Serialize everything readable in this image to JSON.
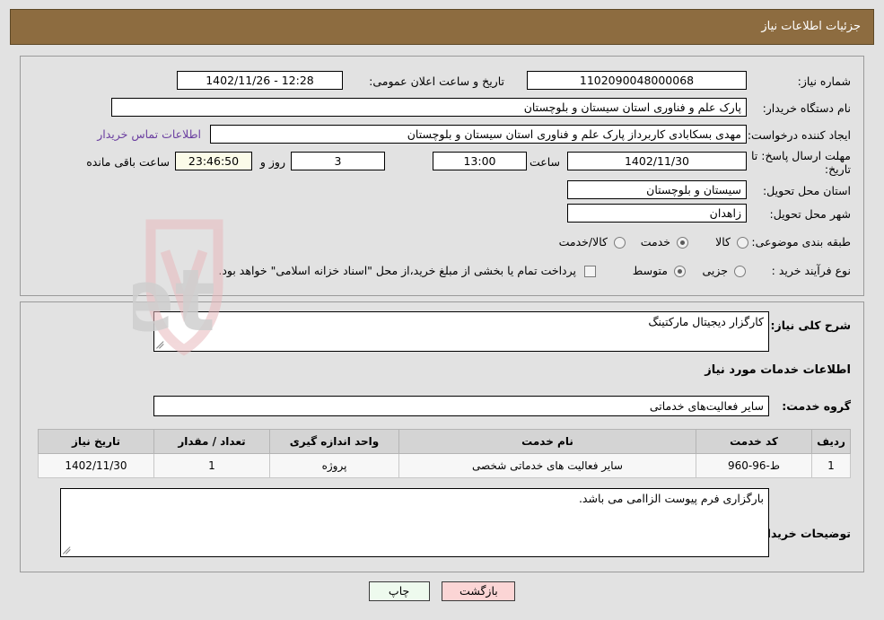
{
  "header": {
    "title": "جزئیات اطلاعات نیاز"
  },
  "colors": {
    "header_bg": "#8d6c40",
    "page_bg": "#e2e2e2",
    "link": "#6b3fa0",
    "timer_field_bg": "#fbfbe8",
    "print_btn_bg": "#eefaee",
    "back_btn_bg": "#fbd5d5",
    "watermark": "#c9c9c9",
    "watermark_logo": "#e8b9bd"
  },
  "top_section": {
    "need_number": {
      "label": "شماره نیاز:",
      "value": "1102090048000068"
    },
    "public_announce": {
      "label": "تاریخ و ساعت اعلان عمومی:",
      "value": "12:28 - 1402/11/26"
    },
    "buyer_org": {
      "label": "نام دستگاه خریدار:",
      "value": "پارک علم و فناوری استان سیستان و بلوچستان"
    },
    "request_creator": {
      "label": "ایجاد کننده درخواست:",
      "value": "مهدی بسکابادی کاربرداز پارک علم و فناوری استان سیستان و بلوچستان",
      "contact_link": "اطلاعات تماس خریدار"
    },
    "deadline": {
      "label": "مهلت ارسال پاسخ: تا تاریخ:",
      "date": "1402/11/30",
      "hour_label": "ساعت",
      "hour": "13:00",
      "days": "3",
      "days_suffix_label": "روز و",
      "countdown": "23:46:50",
      "countdown_suffix_label": "ساعت باقی مانده"
    },
    "delivery_province": {
      "label": "استان محل تحویل:",
      "value": "سیستان و بلوچستان"
    },
    "delivery_city": {
      "label": "شهر محل تحویل:",
      "value": "زاهدان"
    },
    "category": {
      "label": "طبقه بندی موضوعی:",
      "options": [
        {
          "label": "کالا",
          "selected": false
        },
        {
          "label": "خدمت",
          "selected": true
        },
        {
          "label": "کالا/خدمت",
          "selected": false
        }
      ]
    },
    "purchase_process": {
      "label": "نوع فرآیند خرید :",
      "options": [
        {
          "label": "جزیی",
          "selected": false
        },
        {
          "label": "متوسط",
          "selected": true
        }
      ],
      "treasury_checkbox": {
        "checked": false,
        "label": "پرداخت تمام یا بخشی از مبلغ خرید،از محل \"اسناد خزانه اسلامی\" خواهد بود."
      }
    }
  },
  "mid_section": {
    "general_desc": {
      "label": "شرح کلی نیاز:",
      "value": "کارگزار دیجیتال مارکتینگ"
    },
    "services_heading": "اطلاعات خدمات مورد نیاز",
    "service_group": {
      "label": "گروه خدمت:",
      "value": "سایر فعالیت‌های خدماتی"
    },
    "buyer_notes": {
      "label": "توضیحات خریدار:",
      "value": "بارگزاری فرم پیوست الزاامی می باشد."
    }
  },
  "table": {
    "columns": [
      "ردیف",
      "کد خدمت",
      "نام خدمت",
      "واحد اندازه گیری",
      "تعداد / مقدار",
      "تاریخ نیاز"
    ],
    "rows": [
      {
        "radif": "1",
        "code": "ط-96-960",
        "name": "سایر فعالیت های خدماتی شخصی",
        "unit": "پروژه",
        "qty": "1",
        "date": "1402/11/30"
      }
    ]
  },
  "footer": {
    "print_label": "چاپ",
    "back_label": "بازگشت"
  },
  "watermark": {
    "text": "AriaTender.net"
  }
}
